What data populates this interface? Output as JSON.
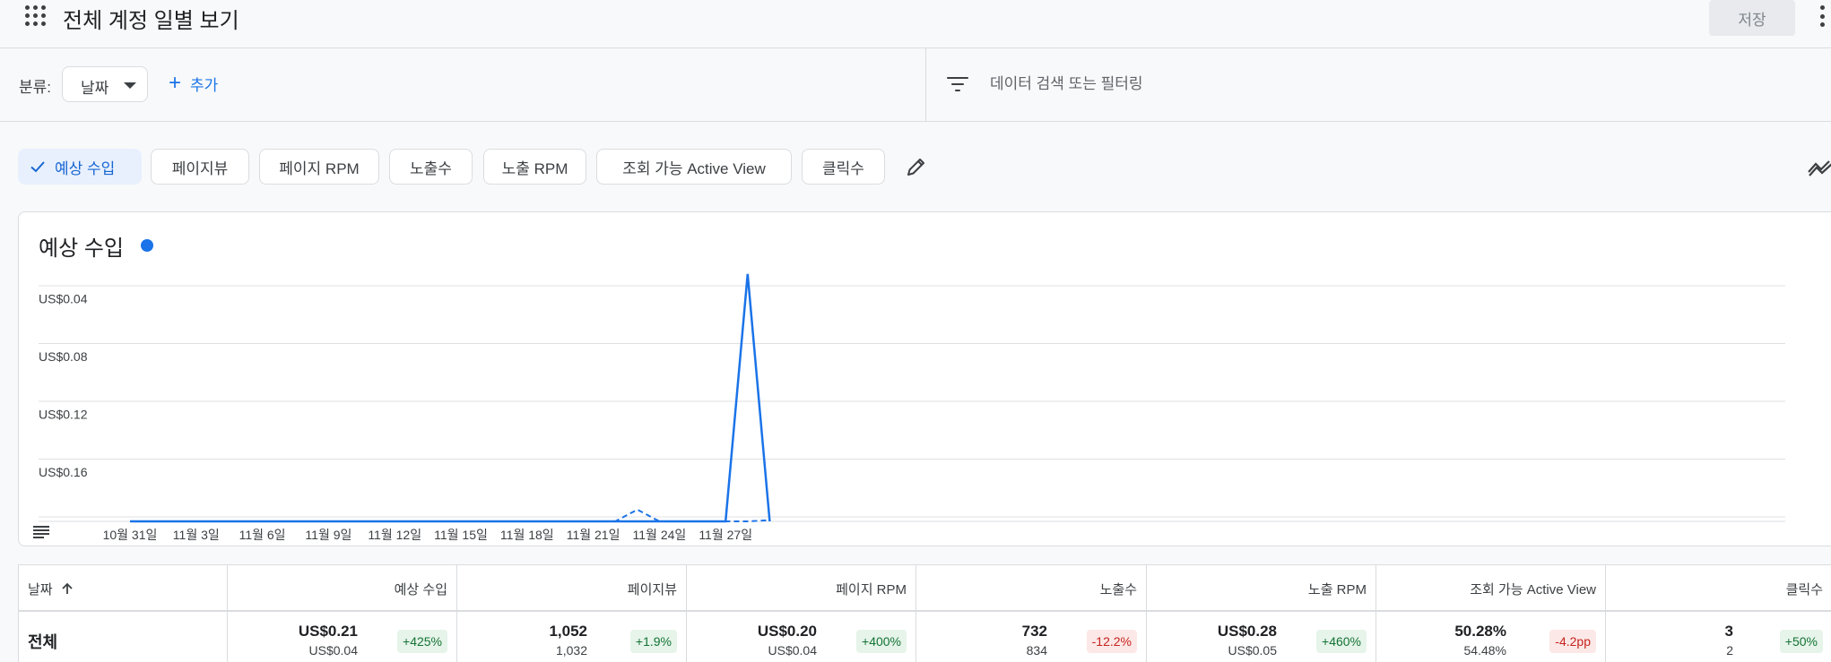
{
  "header": {
    "title": "전체 계정 일별 보기",
    "save_label": "저장"
  },
  "filterbar": {
    "category_label": "분류:",
    "date_select_value": "날짜",
    "add_label": "추가",
    "search_placeholder": "데이터 검색 또는 필터링"
  },
  "chips": [
    {
      "label": "예상 수입",
      "selected": true
    },
    {
      "label": "페이지뷰",
      "selected": false
    },
    {
      "label": "페이지 RPM",
      "selected": false
    },
    {
      "label": "노출수",
      "selected": false
    },
    {
      "label": "노출 RPM",
      "selected": false
    },
    {
      "label": "조회 가능 Active View",
      "selected": false
    },
    {
      "label": "클릭수",
      "selected": false
    }
  ],
  "chart_data": {
    "type": "line",
    "title": "예상 수입",
    "xlabel": "",
    "ylabel": "",
    "ylim": [
      0,
      0.2
    ],
    "grid": true,
    "y_ticks": [
      "US$0.04",
      "US$0.08",
      "US$0.12",
      "US$0.16"
    ],
    "x_ticks": [
      "10월 31일",
      "11월 3일",
      "11월 6일",
      "11월 9일",
      "11월 12일",
      "11월 15일",
      "11월 18일",
      "11월 21일",
      "11월 24일",
      "11월 27일"
    ],
    "x_tick_index": [
      0,
      3,
      6,
      9,
      12,
      15,
      18,
      21,
      24,
      27
    ],
    "series": [
      {
        "style": "solid",
        "color": "#1a73e8",
        "values": [
          0,
          0,
          0,
          0,
          0,
          0,
          0,
          0,
          0,
          0,
          0,
          0,
          0,
          0,
          0,
          0,
          0,
          0,
          0,
          0,
          0,
          0,
          0,
          0,
          0,
          0,
          0,
          0,
          0.21,
          0
        ]
      },
      {
        "style": "dashed",
        "color": "#1a73e8",
        "values": [
          0,
          0,
          0,
          0,
          0,
          0,
          0,
          0,
          0,
          0,
          0,
          0,
          0,
          0,
          0,
          0,
          0,
          0,
          0,
          0,
          0,
          0,
          0,
          0.01,
          0,
          0,
          0,
          0,
          0,
          0.001
        ]
      }
    ]
  },
  "table": {
    "columns": [
      {
        "label": "날짜"
      },
      {
        "label": "예상 수입"
      },
      {
        "label": "페이지뷰"
      },
      {
        "label": "페이지 RPM"
      },
      {
        "label": "노출수"
      },
      {
        "label": "노출 RPM"
      },
      {
        "label": "조회 가능 Active View"
      },
      {
        "label": "클릭수"
      }
    ],
    "total_label": "전체",
    "total": [
      {
        "main": "US$0.21",
        "sub": "US$0.04",
        "change": "+425%",
        "trend": "up"
      },
      {
        "main": "1,052",
        "sub": "1,032",
        "change": "+1.9%",
        "trend": "up"
      },
      {
        "main": "US$0.20",
        "sub": "US$0.04",
        "change": "+400%",
        "trend": "up"
      },
      {
        "main": "732",
        "sub": "834",
        "change": "-12.2%",
        "trend": "down"
      },
      {
        "main": "US$0.28",
        "sub": "US$0.05",
        "change": "+460%",
        "trend": "up"
      },
      {
        "main": "50.28%",
        "sub": "54.48%",
        "change": "-4.2pp",
        "trend": "down"
      },
      {
        "main": "3",
        "sub": "2",
        "change": "+50%",
        "trend": "up"
      }
    ]
  },
  "icons": {
    "apps": "apps-grid-icon",
    "more": "more-vert-icon",
    "filter": "filter-icon",
    "edit": "pencil-icon",
    "compare": "trend-icon"
  }
}
